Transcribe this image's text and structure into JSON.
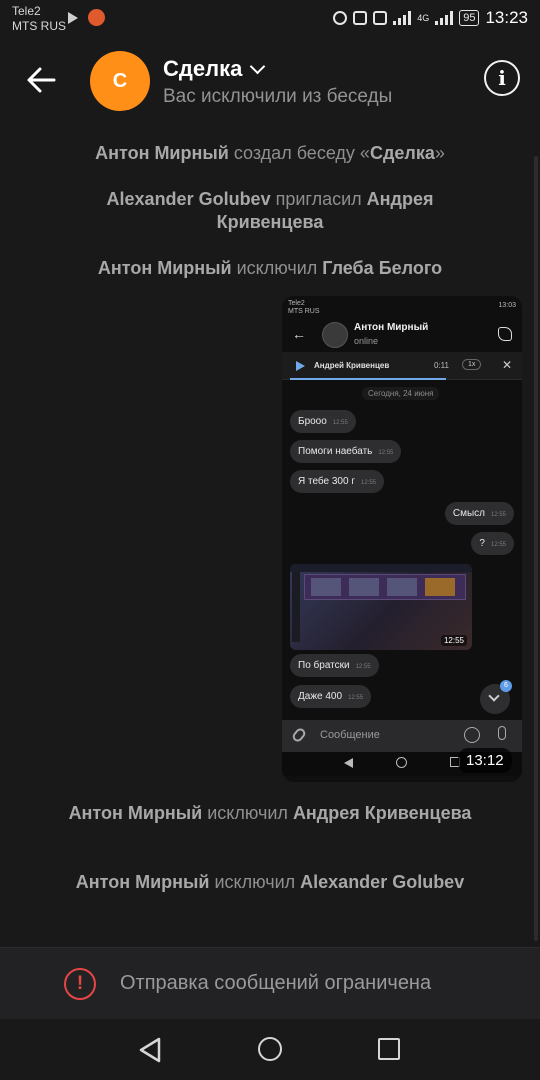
{
  "status_bar": {
    "carrier_line1": "Tele2",
    "carrier_line2": "MTS RUS",
    "network": "4G",
    "battery": "95",
    "time": "13:23"
  },
  "header": {
    "avatar_letter": "C",
    "title": "Сделка",
    "subtitle": "Вас исключили из беседы"
  },
  "system_messages": [
    {
      "actor": "Антон Мирный",
      "action": " создал беседу «",
      "target": "Сделка",
      "suffix": "»"
    },
    {
      "actor": "Alexander Golubev",
      "action": " пригласил ",
      "target": "Андрея Кривенцева",
      "suffix": ""
    },
    {
      "actor": "Антон Мирный",
      "action": " исключил ",
      "target": "Глеба Белого",
      "suffix": ""
    },
    {
      "actor": "Антон Мирный",
      "action": " исключил ",
      "target": "Андрея Кривенцева",
      "suffix": ""
    },
    {
      "actor": "Антон Мирный",
      "action": " исключил ",
      "target": "Alexander Golubev",
      "suffix": ""
    }
  ],
  "attachment": {
    "time": "13:12",
    "status_carrier1": "Tele2",
    "status_carrier2": "MTS RUS",
    "status_time": "13:03",
    "contact_name": "Антон Мирный",
    "contact_status": "online",
    "player_title": "Андрей Кривенцев",
    "player_time": "0:11",
    "player_speed": "1x",
    "date_label": "Сегодня, 24 июня",
    "messages": [
      {
        "text": "Броoo",
        "time": "12:55"
      },
      {
        "text": "Помоги наебать",
        "time": "12:55"
      },
      {
        "text": "Я тебе 300 г",
        "time": "12:55"
      },
      {
        "text": "Смысл",
        "time": "12:55"
      },
      {
        "text": "?",
        "time": "12:55"
      },
      {
        "text": "По братски",
        "time": "12:55"
      },
      {
        "text": "Даже 400",
        "time": "12:55"
      }
    ],
    "video_duration": "12:55",
    "unread_badge": "6",
    "input_placeholder": "Сообщение"
  },
  "restricted": {
    "text": "Отправка сообщений ограничена"
  },
  "colors": {
    "background": "#19191a",
    "avatar": "#ff8f16",
    "warning": "#e64646",
    "accent_blue": "#71aaeb"
  },
  "icons": [
    "back-arrow-icon",
    "chevron-down-icon",
    "info-icon",
    "warning-icon",
    "nav-back-icon",
    "nav-home-icon",
    "nav-recent-icon"
  ]
}
